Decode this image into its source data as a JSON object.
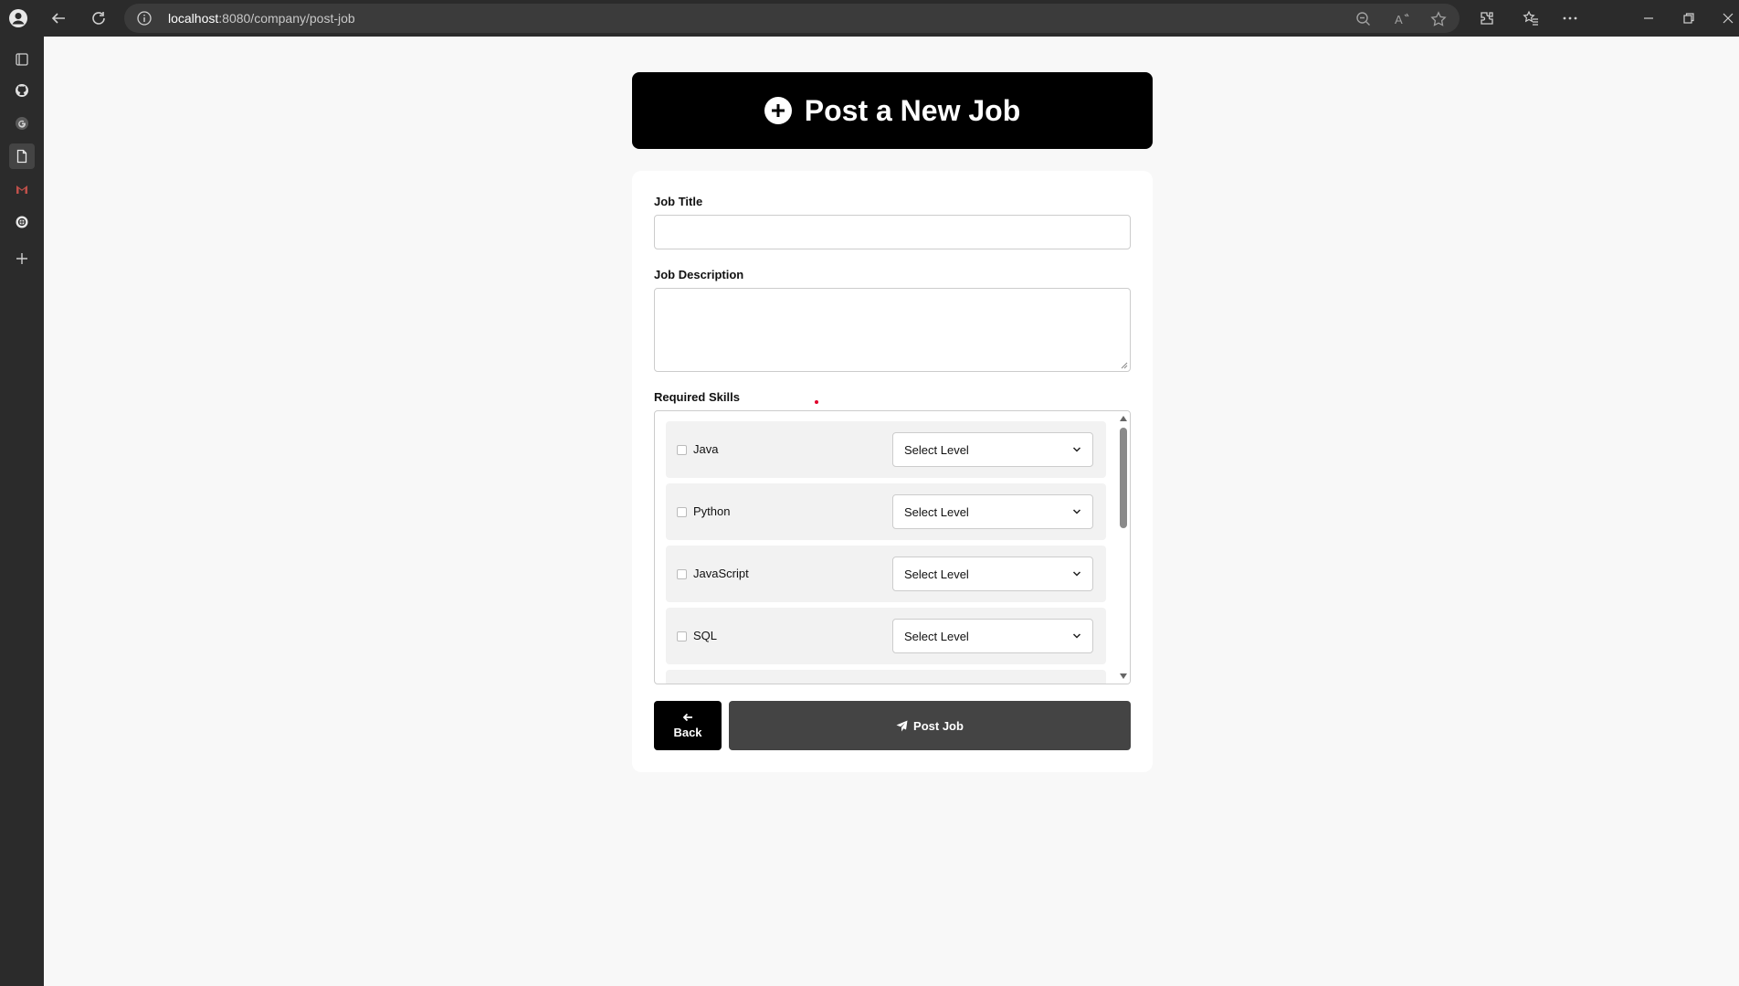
{
  "browser": {
    "url_host": "localhost",
    "url_path": ":8080/company/post-job"
  },
  "page": {
    "heading": "Post a New Job",
    "fields": {
      "job_title_label": "Job Title",
      "job_title_value": "",
      "job_description_label": "Job Description",
      "job_description_value": "",
      "required_skills_label": "Required Skills"
    },
    "skills": [
      {
        "name": "Java",
        "level": "Select Level"
      },
      {
        "name": "Python",
        "level": "Select Level"
      },
      {
        "name": "JavaScript",
        "level": "Select Level"
      },
      {
        "name": "SQL",
        "level": "Select Level"
      }
    ],
    "buttons": {
      "back": "Back",
      "post": "Post Job"
    }
  },
  "colors": {
    "header_bg": "#000000",
    "post_button_bg": "#444444",
    "browser_chrome": "#2b2b2b"
  }
}
